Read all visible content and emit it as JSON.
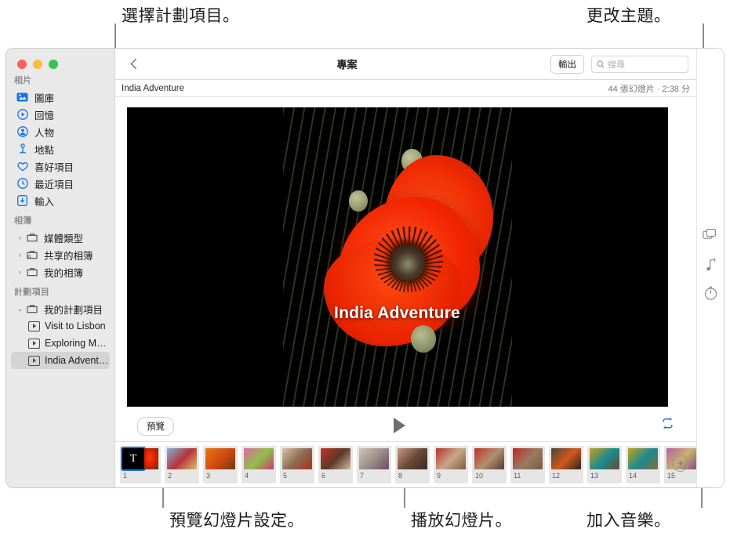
{
  "callouts": [
    {
      "id": "select-project",
      "text": "選擇計劃項目。"
    },
    {
      "id": "change-theme",
      "text": "更改主題。"
    },
    {
      "id": "preview-settings",
      "text": "預覽幻燈片設定。"
    },
    {
      "id": "play-slideshow",
      "text": "播放幻燈片。"
    },
    {
      "id": "add-music",
      "text": "加入音樂。"
    }
  ],
  "sidebar": {
    "photos_header": "相片",
    "photos_items": [
      {
        "label": "圖庫",
        "icon": "library-icon"
      },
      {
        "label": "回憶",
        "icon": "memories-icon"
      },
      {
        "label": "人物",
        "icon": "people-icon"
      },
      {
        "label": "地點",
        "icon": "places-icon"
      },
      {
        "label": "喜好項目",
        "icon": "favorites-icon"
      },
      {
        "label": "最近項目",
        "icon": "recents-icon"
      },
      {
        "label": "輸入",
        "icon": "import-icon"
      }
    ],
    "albums_header": "相簿",
    "albums_items": [
      {
        "label": "媒體類型",
        "icon": "folder-icon",
        "disclosure": "›"
      },
      {
        "label": "共享的相簿",
        "icon": "shared-album-icon",
        "disclosure": "›"
      },
      {
        "label": "我的相簿",
        "icon": "folder-icon",
        "disclosure": "›"
      }
    ],
    "projects_header": "計劃項目",
    "projects_group": {
      "label": "我的計劃項目",
      "icon": "folder-icon",
      "disclosure": "⌄"
    },
    "projects_items": [
      {
        "label": "Visit to Lisbon",
        "selected": false
      },
      {
        "label": "Exploring Mor...",
        "selected": false
      },
      {
        "label": "India Adventure",
        "selected": true
      }
    ]
  },
  "toolbar": {
    "back_icon": "chevron-left-icon",
    "title": "專案",
    "export_label": "輸出",
    "search_placeholder": "搜尋",
    "search_value": "",
    "search_icon": "search-icon"
  },
  "subbar": {
    "project_name": "India Adventure",
    "meta": "44 張幻燈片 · 2:38 分"
  },
  "preview": {
    "slide_title": "India Adventure",
    "image_description": "red-poppy-flower-photo"
  },
  "playback": {
    "preview_label": "預覽",
    "play_icon": "play-icon",
    "loop_icon": "loop-icon",
    "loop_color": "#1a74e8"
  },
  "filmstrip": {
    "add_icon": "plus-icon",
    "slides": [
      {
        "num": "1",
        "kind": "title",
        "letter": "T",
        "selected": true
      },
      {
        "num": "2",
        "kind": "photo",
        "c1": "#7fb2dd",
        "c2": "#b8333a",
        "c3": "#d9c070"
      },
      {
        "num": "3",
        "kind": "photo",
        "c1": "#e8760f",
        "c2": "#d24a10",
        "c3": "#6b3a12"
      },
      {
        "num": "4",
        "kind": "photo",
        "c1": "#e06aa0",
        "c2": "#8fbf4a",
        "c3": "#c93b6a"
      },
      {
        "num": "5",
        "kind": "photo",
        "c1": "#d9c2a8",
        "c2": "#8a6a50",
        "c3": "#b03020"
      },
      {
        "num": "6",
        "kind": "photo",
        "c1": "#c43226",
        "c2": "#5a3a2a",
        "c3": "#d8b898"
      },
      {
        "num": "7",
        "kind": "photo",
        "c1": "#cfc2b8",
        "c2": "#9a8f88",
        "c3": "#6a4a60"
      },
      {
        "num": "8",
        "kind": "photo",
        "c1": "#c99a80",
        "c2": "#6a4838",
        "c3": "#3a2a22"
      },
      {
        "num": "9",
        "kind": "photo",
        "c1": "#b5352a",
        "c2": "#c8a88a",
        "c3": "#7a5a44"
      },
      {
        "num": "10",
        "kind": "photo",
        "c1": "#c03028",
        "c2": "#b09070",
        "c3": "#5a3a2c"
      },
      {
        "num": "11",
        "kind": "photo",
        "c1": "#c02820",
        "c2": "#9a7a60",
        "c3": "#7a5a48"
      },
      {
        "num": "12",
        "kind": "photo",
        "c1": "#4a4238",
        "c2": "#d2581c",
        "c3": "#2a2420"
      },
      {
        "num": "13",
        "kind": "photo",
        "c1": "#c8a018",
        "c2": "#1a8a92",
        "c3": "#6a4a2a"
      },
      {
        "num": "14",
        "kind": "photo",
        "c1": "#c8a018",
        "c2": "#1a8a92",
        "c3": "#8a6a3a"
      },
      {
        "num": "15",
        "kind": "photo",
        "c1": "#b8609a",
        "c2": "#c8b070",
        "c3": "#8a4a7a"
      }
    ]
  },
  "rail": {
    "items": [
      {
        "icon": "theme-icon",
        "name": "theme"
      },
      {
        "icon": "music-note-icon",
        "name": "music"
      },
      {
        "icon": "duration-timer-icon",
        "name": "duration"
      }
    ]
  }
}
